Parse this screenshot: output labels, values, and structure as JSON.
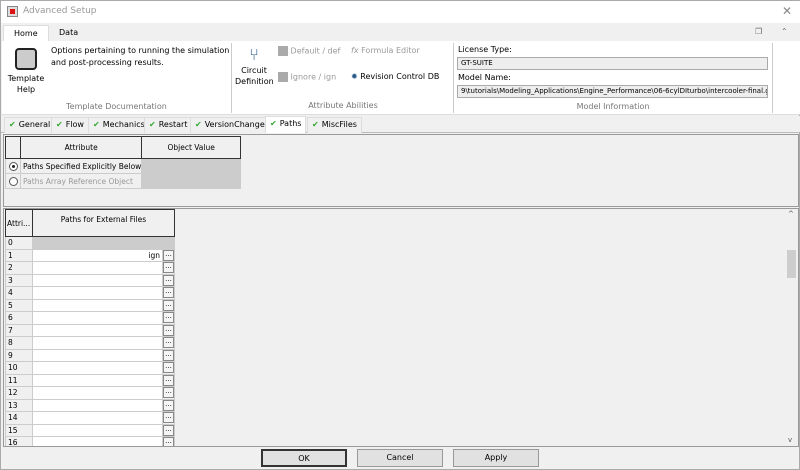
{
  "window": {
    "title": "Advanced Setup"
  },
  "ribbon": {
    "tabs": [
      "Home",
      "Data"
    ],
    "template_help": "Template Help",
    "description": "Options pertaining to running the simulation and post-processing results.",
    "group_template_doc": "Template Documentation",
    "circuit_definition": "Circuit Definition",
    "default_def": "Default / def",
    "ignore_ign": "Ignore / ign",
    "formula_editor": "Formula Editor",
    "revision_control": "Revision Control DB",
    "group_attribute_abilities": "Attribute Abilities",
    "license_type_label": "License Type:",
    "license_type_value": "GT-SUITE",
    "model_name_label": "Model Name:",
    "model_name_value": "9\\tutorials\\Modeling_Applications\\Engine_Performance\\06-6cylDIturbo\\intercooler-final.gtm",
    "group_model_info": "Model Information"
  },
  "sheet_tabs": [
    "General",
    "Flow",
    "Mechanics",
    "Restart",
    "VersionChanges",
    "Paths",
    "MiscFiles"
  ],
  "active_sheet_tab": "Paths",
  "attr_table": {
    "headers": [
      "Attribute",
      "Object Value"
    ],
    "rows": [
      {
        "label": "Paths Specified Explicitly Below",
        "selected": true,
        "enabled": true
      },
      {
        "label": "Paths Array Reference Object",
        "selected": false,
        "enabled": false
      }
    ]
  },
  "paths_table": {
    "headers": [
      "Attri...",
      "Paths for External Files"
    ],
    "rows": [
      {
        "n": "0",
        "v": ""
      },
      {
        "n": "1",
        "v": "ign"
      },
      {
        "n": "2",
        "v": ""
      },
      {
        "n": "3",
        "v": ""
      },
      {
        "n": "4",
        "v": ""
      },
      {
        "n": "5",
        "v": ""
      },
      {
        "n": "6",
        "v": ""
      },
      {
        "n": "7",
        "v": ""
      },
      {
        "n": "8",
        "v": ""
      },
      {
        "n": "9",
        "v": ""
      },
      {
        "n": "10",
        "v": ""
      },
      {
        "n": "11",
        "v": ""
      },
      {
        "n": "12",
        "v": ""
      },
      {
        "n": "13",
        "v": ""
      },
      {
        "n": "14",
        "v": ""
      },
      {
        "n": "15",
        "v": ""
      },
      {
        "n": "16",
        "v": ""
      }
    ],
    "browse_label": "..."
  },
  "buttons": {
    "ok": "OK",
    "cancel": "Cancel",
    "apply": "Apply"
  }
}
